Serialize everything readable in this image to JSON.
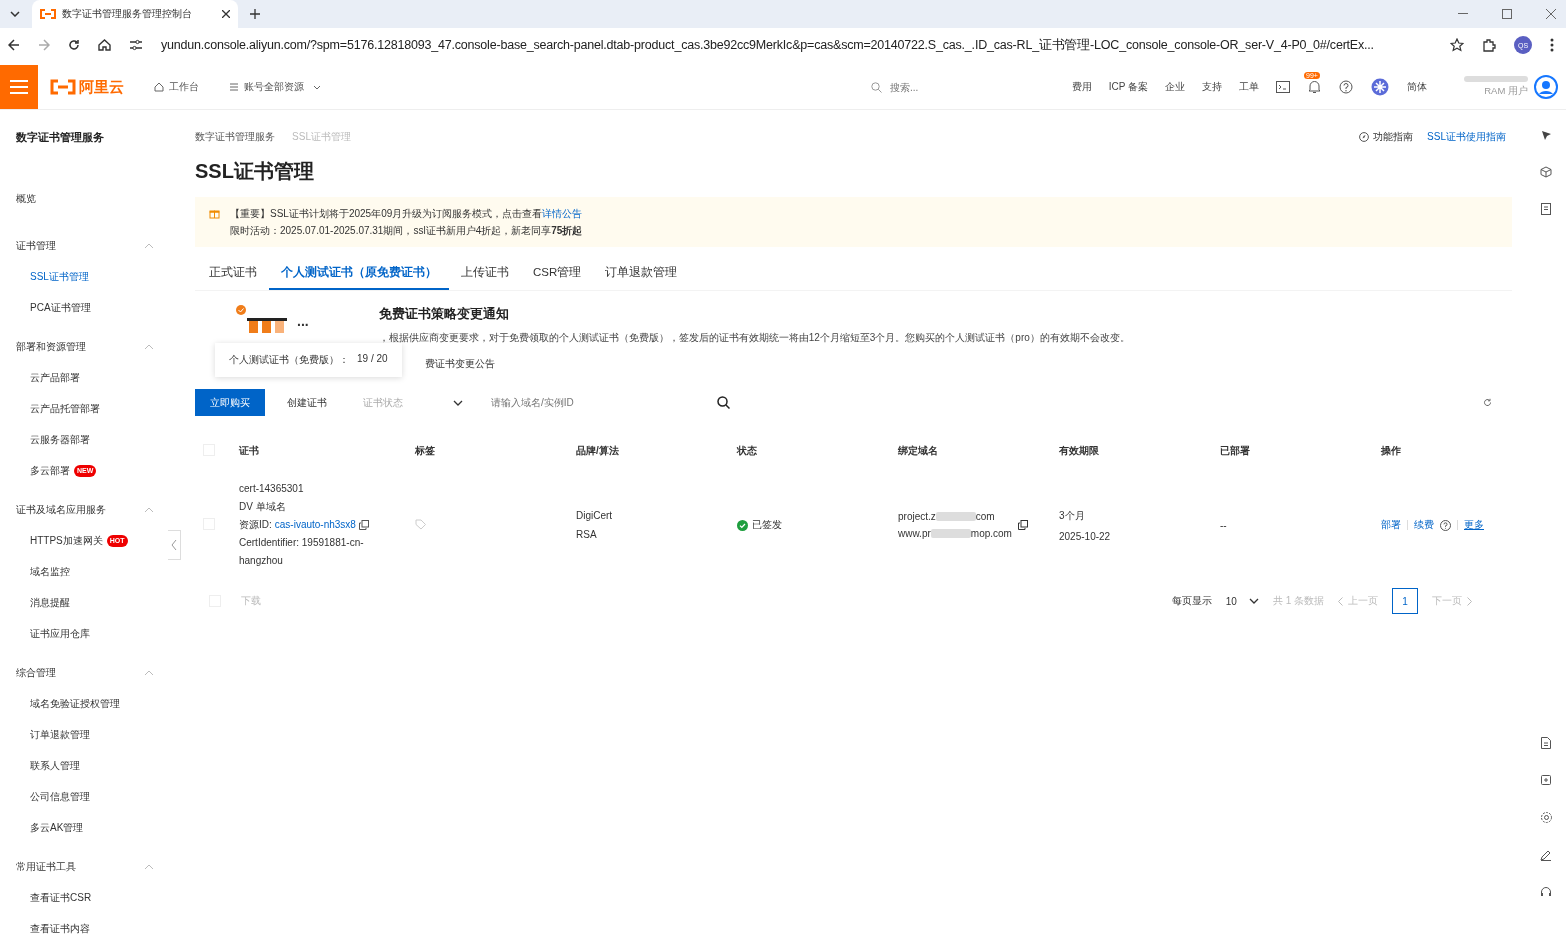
{
  "browser": {
    "tab_title": "数字证书管理服务管理控制台",
    "url": "yundun.console.aliyun.com/?spm=5176.12818093_47.console-base_search-panel.dtab-product_cas.3be92cc9MerkIc&p=cas&scm=20140722.S_cas._.ID_cas-RL_证书管理-LOC_console_console-OR_ser-V_4-P0_0#/certEx...",
    "profile": "QS"
  },
  "header": {
    "logo": "阿里云",
    "nav": [
      "工作台",
      "账号全部资源"
    ],
    "search_placeholder": "搜索...",
    "links": [
      "费用",
      "ICP 备案",
      "企业",
      "支持",
      "工单"
    ],
    "notification_badge": "99+",
    "language": "简体",
    "user_role": "RAM 用户"
  },
  "sidebar": {
    "title": "数字证书管理服务",
    "items": [
      {
        "kind": "item",
        "label": "概览",
        "selected": false
      },
      {
        "kind": "group",
        "label": "证书管理",
        "expanded": true,
        "children": [
          {
            "label": "SSL证书管理",
            "selected": true
          },
          {
            "label": "PCA证书管理",
            "selected": false
          }
        ]
      },
      {
        "kind": "group",
        "label": "部署和资源管理",
        "expanded": true,
        "children": [
          {
            "label": "云产品部署",
            "selected": false
          },
          {
            "label": "云产品托管部署",
            "selected": false
          },
          {
            "label": "云服务器部署",
            "selected": false
          },
          {
            "label": "多云部署",
            "selected": false,
            "badge": "NEW"
          }
        ]
      },
      {
        "kind": "group",
        "label": "证书及域名应用服务",
        "expanded": true,
        "children": [
          {
            "label": "HTTPS加速网关",
            "selected": false,
            "badge": "HOT"
          },
          {
            "label": "域名监控",
            "selected": false
          },
          {
            "label": "消息提醒",
            "selected": false
          },
          {
            "label": "证书应用仓库",
            "selected": false
          }
        ]
      },
      {
        "kind": "group",
        "label": "综合管理",
        "expanded": true,
        "children": [
          {
            "label": "域名免验证授权管理",
            "selected": false
          },
          {
            "label": "订单退款管理",
            "selected": false
          },
          {
            "label": "联系人管理",
            "selected": false
          },
          {
            "label": "公司信息管理",
            "selected": false
          },
          {
            "label": "多云AK管理",
            "selected": false
          }
        ]
      },
      {
        "kind": "group",
        "label": "常用证书工具",
        "expanded": true,
        "children": [
          {
            "label": "查看证书CSR",
            "selected": false
          },
          {
            "label": "查看证书内容",
            "selected": false
          }
        ]
      }
    ]
  },
  "breadcrumb": [
    "数字证书管理服务",
    "SSL证书管理"
  ],
  "page_title": "SSL证书管理",
  "guides": [
    "功能指南",
    "SSL证书使用指南"
  ],
  "notice": {
    "line_1": "【重要】SSL证书计划将于2025年09月升级为订阅服务模式，点击查看",
    "link": "详情公告",
    "line_2": "限时活动：2025.07.01-2025.07.31期间，ssl证书新用户4折起，新老同享**75折起**"
  },
  "tabs": [
    {
      "label": "正式证书",
      "selected": false
    },
    {
      "label": "个人测试证书（原免费证书）",
      "selected": true
    },
    {
      "label": "上传证书",
      "selected": false
    },
    {
      "label": "CSR管理",
      "selected": false
    },
    {
      "label": "订单退款管理",
      "selected": false
    }
  ],
  "promo": {
    "title": "免费证书策略变更通知",
    "body": "，根据供应商变更要求，对于免费领取的个人测试证书（免费版），签发后的证书有效期统一将由12个月缩短至3个月。您购买的个人测试证书（pro）的有效期不会改变。",
    "link": "费证书变更公告",
    "more": "..."
  },
  "quota_tooltip": {
    "label": "个人测试证书（免费版）：",
    "value": "19 / 20"
  },
  "toolbar": {
    "buy": "立即购买",
    "create": "创建证书",
    "status_placeholder": "证书状态",
    "search_placeholder": "请输入域名/实例ID"
  },
  "table": {
    "select_all_checked": false,
    "columns": [
      "证书",
      "标签",
      "品牌/算法",
      "状态",
      "绑定域名",
      "有效期限",
      "已部署",
      "操作"
    ],
    "rows": [
      {
        "checked": false,
        "cert_id": "cert-14365301",
        "cert_type": "DV 单域名",
        "resource_prefix": "资源ID:",
        "resource_id": "cas-ivauto-nh3sx8",
        "identifier": "CertIdentifier: 19591881-cn-hangzhou",
        "brand": "DigiCert",
        "algorithm": "RSA",
        "status": "已签发",
        "domains": [
          {
            "start": "project.z",
            "end": "com"
          },
          {
            "start": "www.pr",
            "end": "mop.com"
          }
        ],
        "validity": "3个月",
        "expires": "2025-10-22",
        "deployed": "--",
        "actions": [
          "部署",
          "续费",
          "更多"
        ]
      }
    ]
  },
  "footer": {
    "checked": false,
    "download": "下载",
    "page_size_label": "每页显示",
    "page_size": "10",
    "total": "共 1 条数据",
    "prev": "上一页",
    "page": "1",
    "next": "下一页"
  }
}
